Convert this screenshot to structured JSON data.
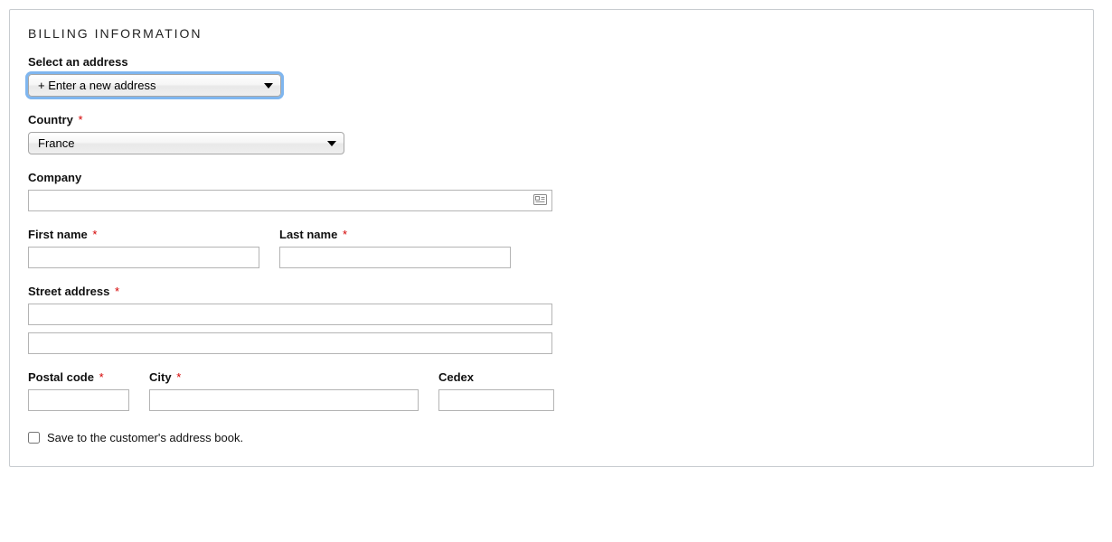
{
  "panel": {
    "title": "BILLING INFORMATION"
  },
  "fields": {
    "select_address": {
      "label": "Select an address",
      "value": "+ Enter a new address"
    },
    "country": {
      "label": "Country",
      "required_mark": "*",
      "value": "France"
    },
    "company": {
      "label": "Company",
      "value": ""
    },
    "first_name": {
      "label": "First name",
      "required_mark": "*",
      "value": ""
    },
    "last_name": {
      "label": "Last name",
      "required_mark": "*",
      "value": ""
    },
    "street": {
      "label": "Street address",
      "required_mark": "*",
      "line1": "",
      "line2": ""
    },
    "postal": {
      "label": "Postal code",
      "required_mark": "*",
      "value": ""
    },
    "city": {
      "label": "City",
      "required_mark": "*",
      "value": ""
    },
    "cedex": {
      "label": "Cedex",
      "value": ""
    },
    "save_to_book": {
      "label": "Save to the customer's address book.",
      "checked": false
    }
  }
}
